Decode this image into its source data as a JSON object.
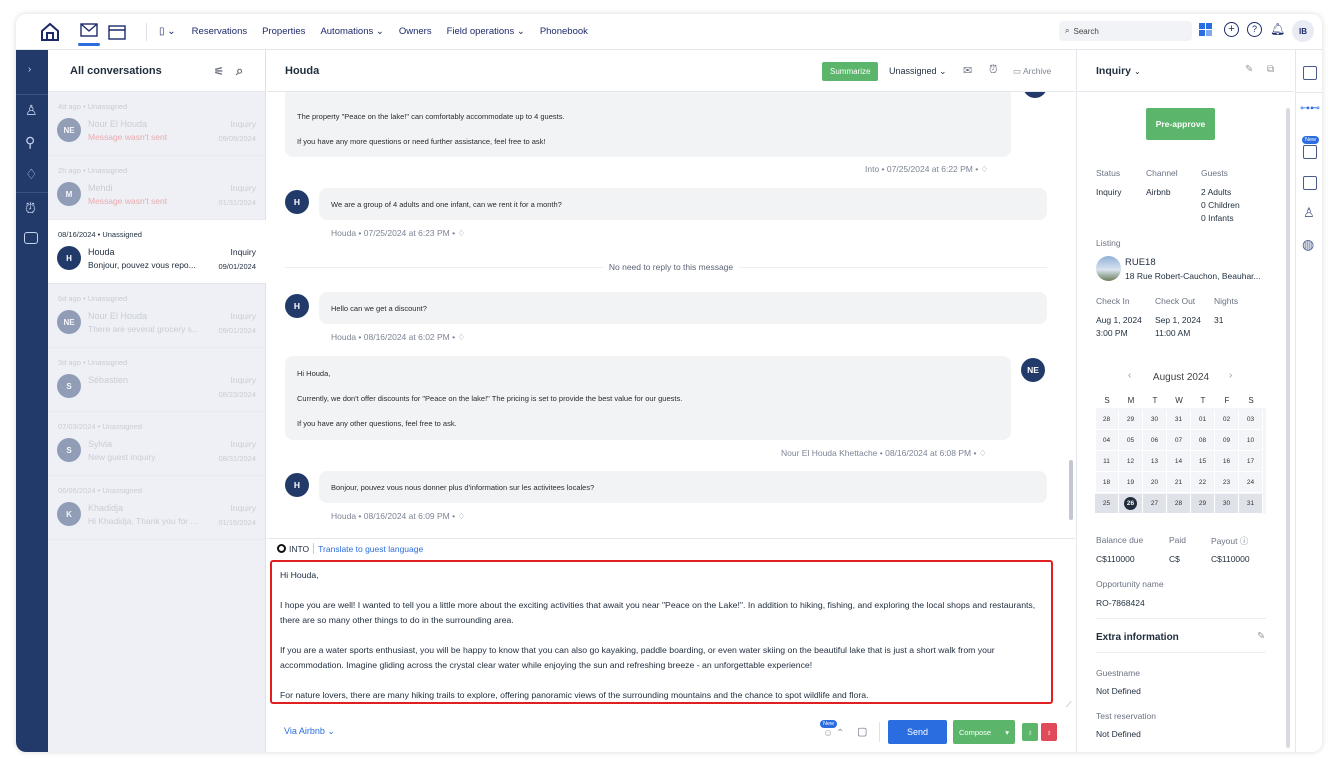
{
  "topnav": {
    "nav": [
      "Reservations",
      "Properties",
      "Automations",
      "Owners",
      "Field operations",
      "Phonebook"
    ],
    "search_placeholder": "Search",
    "user_initials": "IB"
  },
  "conversations": {
    "title": "All conversations",
    "items": [
      {
        "meta": "4d ago • Unassigned",
        "initials": "NE",
        "name": "Nour El Houda",
        "preview": "Message wasn't sent",
        "status": "Inquiry",
        "date": "09/09/2024"
      },
      {
        "meta": "2h ago • Unassigned",
        "initials": "M",
        "name": "Mehdi",
        "preview": "Message wasn't sent",
        "status": "Inquiry",
        "date": "01/31/2024"
      },
      {
        "meta": "08/16/2024 • Unassigned",
        "initials": "H",
        "name": "Houda",
        "preview": "Bonjour, pouvez vous repo...",
        "status": "Inquiry",
        "date": "09/01/2024"
      },
      {
        "meta": "6d ago • Unassigned",
        "initials": "NE",
        "name": "Nour El Houda",
        "preview": "There are several grocery s...",
        "status": "Inquiry",
        "date": "09/01/2024"
      },
      {
        "meta": "3d ago • Unassigned",
        "initials": "S",
        "name": "Sébastien",
        "preview": "",
        "status": "Inquiry",
        "date": "08/23/2024"
      },
      {
        "meta": "07/03/2024 • Unassigned",
        "initials": "S",
        "name": "Sylvia",
        "preview": "New guest inquiry",
        "status": "Inquiry",
        "date": "08/31/2024"
      },
      {
        "meta": "06/06/2024 • Unassigned",
        "initials": "K",
        "name": "Khadidja",
        "preview": "Hi Khadidja, Thank you for ...",
        "status": "Inquiry",
        "date": "01/16/2024"
      }
    ]
  },
  "chat": {
    "title": "Houda",
    "summarize": "Summarize",
    "assignee": "Unassigned",
    "archive": "Archive",
    "msg1": {
      "line1": "The property \"Peace on the lake!\" can comfortably accommodate up to 4 guests.",
      "line2": "If you have any more questions or need further assistance, feel free to ask!",
      "byline": "Into • 07/25/2024 at 6:22 PM •"
    },
    "msg2": {
      "text": "We are a group of 4 adults and one infant, can we rent it for a month?",
      "byline": "Houda • 07/25/2024 at 6:23 PM •"
    },
    "separator": "No need to reply to this message",
    "msg3": {
      "text": "Hello can we get a discount?",
      "byline": "Houda • 08/16/2024 at 6:02 PM •"
    },
    "msg4": {
      "line1": "Hi Houda,",
      "line2": "Currently, we don't offer discounts for \"Peace on the lake!\" The pricing is set to provide the best value for our guests.",
      "line3": "If you have any other questions, feel free to ask.",
      "byline": "Nour El Houda Khettache • 08/16/2024 at 6:08 PM •",
      "initials": "NE"
    },
    "msg5": {
      "text": "Bonjour, pouvez vous nous donner plus d'information sur les activitees locales?",
      "byline": "Houda • 08/16/2024 at 6:09 PM •"
    },
    "guest_initial": "H",
    "into_label": "INTO",
    "translate_link": "Translate to guest language",
    "composer": [
      "Hi Houda,",
      "I hope you are well! I wanted to tell you a little more about the exciting activities that await you near \"Peace on the Lake!\". In addition to hiking, fishing, and exploring the local shops and restaurants, there are so many other things to do in the surrounding area.",
      "If you are a water sports enthusiast, you will be happy to know that you can also go kayaking, paddle boarding, or even water skiing on the beautiful lake that is just a short walk from your accommodation. Imagine gliding across the crystal clear water while enjoying the sun and refreshing breeze - an unforgettable experience!",
      "For nature lovers, there are many hiking trails to explore, offering panoramic views of the surrounding mountains and the chance to spot wildlife and flora."
    ],
    "via": "Via Airbnb",
    "new_badge": "New",
    "send": "Send",
    "compose": "Compose"
  },
  "details": {
    "title": "Inquiry",
    "preapprove": "Pre-approve",
    "status_label": "Status",
    "status": "Inquiry",
    "channel_label": "Channel",
    "channel": "Airbnb",
    "guests_label": "Guests",
    "guests": [
      "2 Adults",
      "0 Children",
      "0 Infants"
    ],
    "listing_label": "Listing",
    "listing_name": "RUE18",
    "listing_address": "18 Rue Robert-Cauchon, Beauhar...",
    "checkin_label": "Check In",
    "checkin_date": "Aug 1, 2024",
    "checkin_time": "3:00 PM",
    "checkout_label": "Check Out",
    "checkout_date": "Sep 1, 2024",
    "checkout_time": "11:00 AM",
    "nights_label": "Nights",
    "nights": "31",
    "calendar": {
      "month": "August 2024",
      "weekdays": [
        "S",
        "M",
        "T",
        "W",
        "T",
        "F",
        "S"
      ],
      "weeks": [
        [
          "28",
          "29",
          "30",
          "31",
          "01",
          "02",
          "03"
        ],
        [
          "04",
          "05",
          "06",
          "07",
          "08",
          "09",
          "10"
        ],
        [
          "11",
          "12",
          "13",
          "14",
          "15",
          "16",
          "17"
        ],
        [
          "18",
          "19",
          "20",
          "21",
          "22",
          "23",
          "24"
        ],
        [
          "25",
          "26",
          "27",
          "28",
          "29",
          "30",
          "31"
        ]
      ],
      "today": "26"
    },
    "balance_label": "Balance due",
    "balance": "C$110000",
    "paid_label": "Paid",
    "paid": "C$",
    "payout_label": "Payout",
    "payout": "C$110000",
    "opp_label": "Opportunity name",
    "opp": "RO-7868424",
    "extra_title": "Extra information",
    "guestname_label": "Guestname",
    "guestname": "Not Defined",
    "testres_label": "Test reservation",
    "testres": "Not Defined"
  }
}
